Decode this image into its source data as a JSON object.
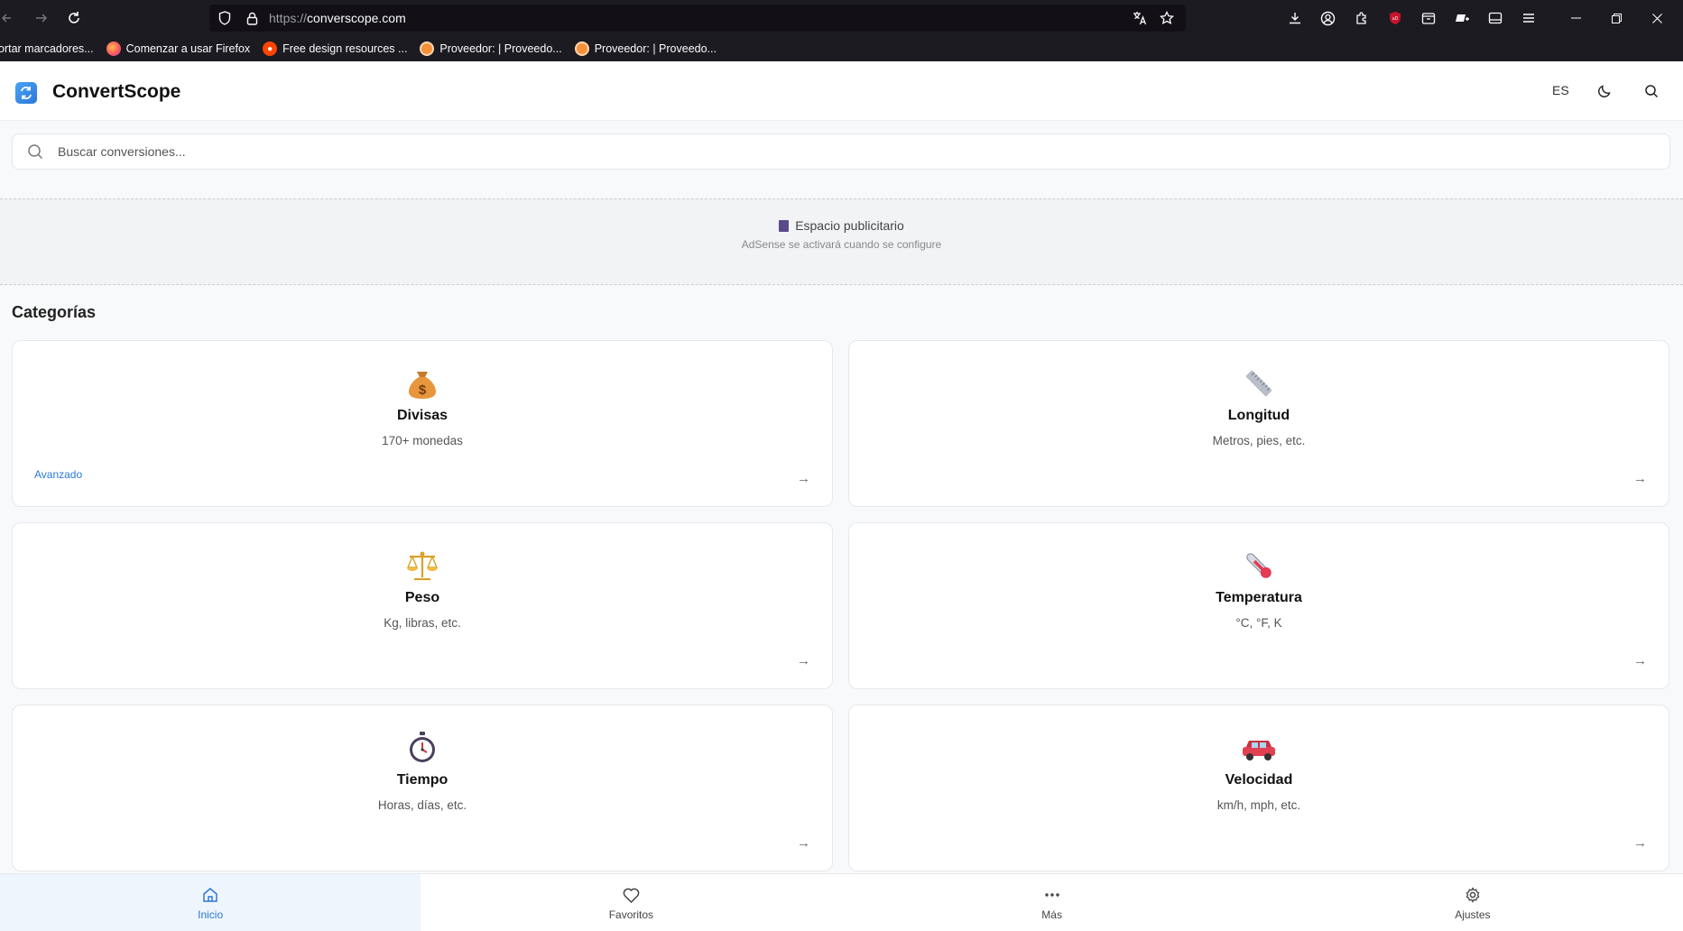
{
  "browser": {
    "url_scheme": "https://",
    "url_host": "converscope.com",
    "bookmarks": [
      {
        "label": "ortar marcadores..."
      },
      {
        "label": "Comenzar a usar Firefox"
      },
      {
        "label": "Free design resources ..."
      },
      {
        "label": "Proveedor: | Proveedo..."
      },
      {
        "label": "Proveedor: | Proveedo..."
      }
    ]
  },
  "header": {
    "brand": "ConvertScope",
    "language": "ES"
  },
  "search": {
    "placeholder": "Buscar conversiones..."
  },
  "ad": {
    "title": "Espacio publicitario",
    "subtitle": "AdSense se activará cuando se configure"
  },
  "categories": {
    "heading": "Categorías",
    "items": [
      {
        "title": "Divisas",
        "subtitle": "170+ monedas",
        "tag": "Avanzado",
        "icon": "money-bag-icon",
        "arrow": "→"
      },
      {
        "title": "Longitud",
        "subtitle": "Metros, pies, etc.",
        "icon": "ruler-icon",
        "arrow": "→"
      },
      {
        "title": "Peso",
        "subtitle": "Kg, libras, etc.",
        "icon": "scale-icon",
        "arrow": "→"
      },
      {
        "title": "Temperatura",
        "subtitle": "°C, °F, K",
        "icon": "thermometer-icon",
        "arrow": "→"
      },
      {
        "title": "Tiempo",
        "subtitle": "Horas, días, etc.",
        "icon": "stopwatch-icon",
        "arrow": "→"
      },
      {
        "title": "Velocidad",
        "subtitle": "km/h, mph, etc.",
        "icon": "car-icon",
        "arrow": "→"
      }
    ]
  },
  "bottom_nav": [
    {
      "label": "Inicio",
      "icon": "home-icon",
      "active": true
    },
    {
      "label": "Favoritos",
      "icon": "heart-icon",
      "active": false
    },
    {
      "label": "Más",
      "icon": "more-icon",
      "active": false
    },
    {
      "label": "Ajustes",
      "icon": "gear-icon",
      "active": false
    }
  ],
  "colors": {
    "accent": "#2a78d8",
    "chrome": "#1c1b22",
    "page_bg": "#f8f9fb"
  }
}
